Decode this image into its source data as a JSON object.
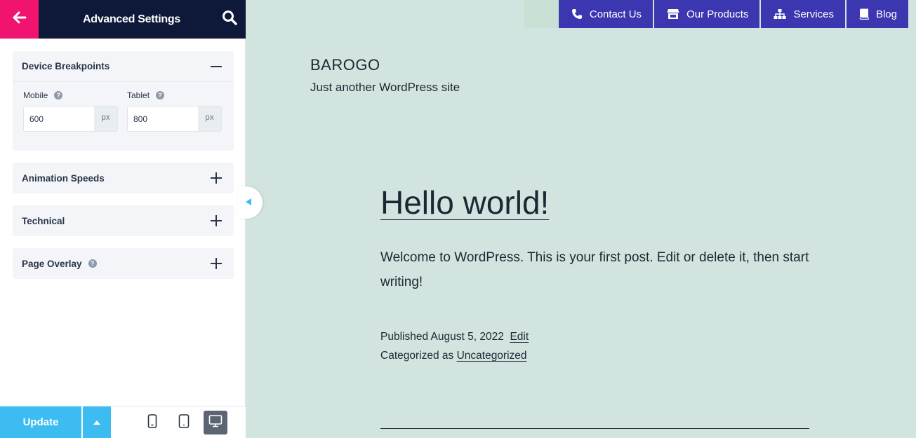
{
  "sidebar": {
    "title": "Advanced Settings",
    "sections": [
      {
        "label": "Device Breakpoints",
        "expanded": true,
        "fields": [
          {
            "label": "Mobile",
            "value": "600",
            "unit": "px"
          },
          {
            "label": "Tablet",
            "value": "800",
            "unit": "px"
          }
        ]
      },
      {
        "label": "Animation Speeds",
        "expanded": false
      },
      {
        "label": "Technical",
        "expanded": false
      },
      {
        "label": "Page Overlay",
        "expanded": false
      }
    ],
    "footer": {
      "update_label": "Update",
      "devices": [
        "mobile",
        "tablet",
        "desktop"
      ],
      "active_device": "desktop"
    }
  },
  "site": {
    "nav": [
      {
        "label": "Contact Us",
        "icon": "phone-icon"
      },
      {
        "label": "Our Products",
        "icon": "store-icon"
      },
      {
        "label": "Services",
        "icon": "sitemap-icon"
      },
      {
        "label": "Blog",
        "icon": "book-icon"
      }
    ],
    "title": "BAROGO",
    "tagline": "Just another WordPress site",
    "post": {
      "title": "Hello world!",
      "body": "Welcome to WordPress. This is your first post. Edit or delete it, then start writing!",
      "published_prefix": "Published",
      "date": "August 5, 2022",
      "edit_label": "Edit",
      "categorized_prefix": "Categorized as",
      "category": "Uncategorized"
    }
  },
  "colors": {
    "header_bg": "#0e1838",
    "back_accent": "#f0136f",
    "update_accent": "#3cbcf0",
    "nav_bg": "#3c36b0",
    "page_bg": "#d2e4df"
  }
}
